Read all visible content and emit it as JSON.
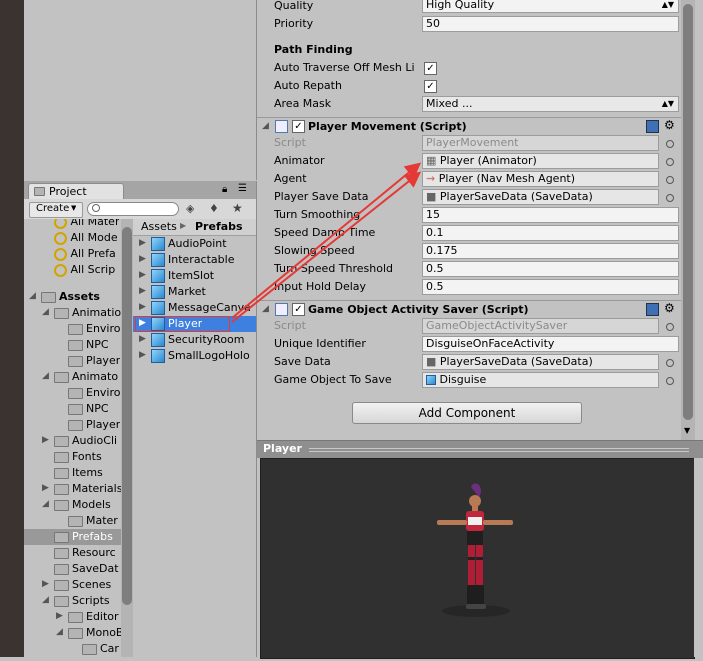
{
  "project_panel": {
    "tab_label": "Project",
    "create_label": "Create",
    "favorites": [
      "All Mater",
      "All Mode",
      "All Prefa",
      "All Scrip"
    ],
    "tree": [
      {
        "label": "Assets",
        "bold": true
      },
      {
        "label": "Animatio"
      },
      {
        "label": "Enviro"
      },
      {
        "label": "NPC"
      },
      {
        "label": "Player"
      },
      {
        "label": "Animato"
      },
      {
        "label": "Enviro"
      },
      {
        "label": "NPC"
      },
      {
        "label": "Player"
      },
      {
        "label": "AudioCli"
      },
      {
        "label": "Fonts"
      },
      {
        "label": "Items"
      },
      {
        "label": "Materials"
      },
      {
        "label": "Models"
      },
      {
        "label": "Mater"
      },
      {
        "label": "Prefabs"
      },
      {
        "label": "Resourc"
      },
      {
        "label": "SaveDat"
      },
      {
        "label": "Scenes"
      },
      {
        "label": "Scripts"
      },
      {
        "label": "Editor"
      },
      {
        "label": "MonoB"
      },
      {
        "label": "Car"
      }
    ],
    "breadcrumb": {
      "root": "Assets",
      "current": "Prefabs"
    },
    "files": [
      "AudioPoint",
      "Interactable",
      "ItemSlot",
      "Market",
      "MessageCanva",
      "Player",
      "SecurityRoom",
      "SmallLogoHolo"
    ]
  },
  "inspector": {
    "quality_label": "Quality",
    "quality_value": "High Quality",
    "priority_label": "Priority",
    "priority_value": "50",
    "path_finding_header": "Path Finding",
    "auto_traverse_label": "Auto Traverse Off Mesh Li",
    "auto_repath_label": "Auto Repath",
    "area_mask_label": "Area Mask",
    "area_mask_value": "Mixed ...",
    "player_movement": {
      "title": "Player Movement (Script)",
      "script_label": "Script",
      "script_value": "PlayerMovement",
      "animator_label": "Animator",
      "animator_value": "Player (Animator)",
      "agent_label": "Agent",
      "agent_value": "Player (Nav Mesh Agent)",
      "save_data_label": "Player Save Data",
      "save_data_value": "PlayerSaveData (SaveData)",
      "turn_smoothing_label": "Turn Smoothing",
      "turn_smoothing_value": "15",
      "speed_damp_label": "Speed Damp Time",
      "speed_damp_value": "0.1",
      "slowing_speed_label": "Slowing Speed",
      "slowing_speed_value": "0.175",
      "turn_threshold_label": "Turn Speed Threshold",
      "turn_threshold_value": "0.5",
      "input_hold_label": "Input Hold Delay",
      "input_hold_value": "0.5"
    },
    "activity_saver": {
      "title": "Game Object Activity Saver (Script)",
      "script_label": "Script",
      "script_value": "GameObjectActivitySaver",
      "unique_id_label": "Unique Identifier",
      "unique_id_value": "DisguiseOnFaceActivity",
      "save_data_label": "Save Data",
      "save_data_value": "PlayerSaveData (SaveData)",
      "go_to_save_label": "Game Object To Save",
      "go_to_save_value": "Disguise"
    },
    "add_component_label": "Add Component"
  },
  "preview": {
    "title": "Player"
  },
  "colors": {
    "selection": "#3d80df",
    "annotation_arrow": "#e53935",
    "preview_bg": "#303030"
  }
}
